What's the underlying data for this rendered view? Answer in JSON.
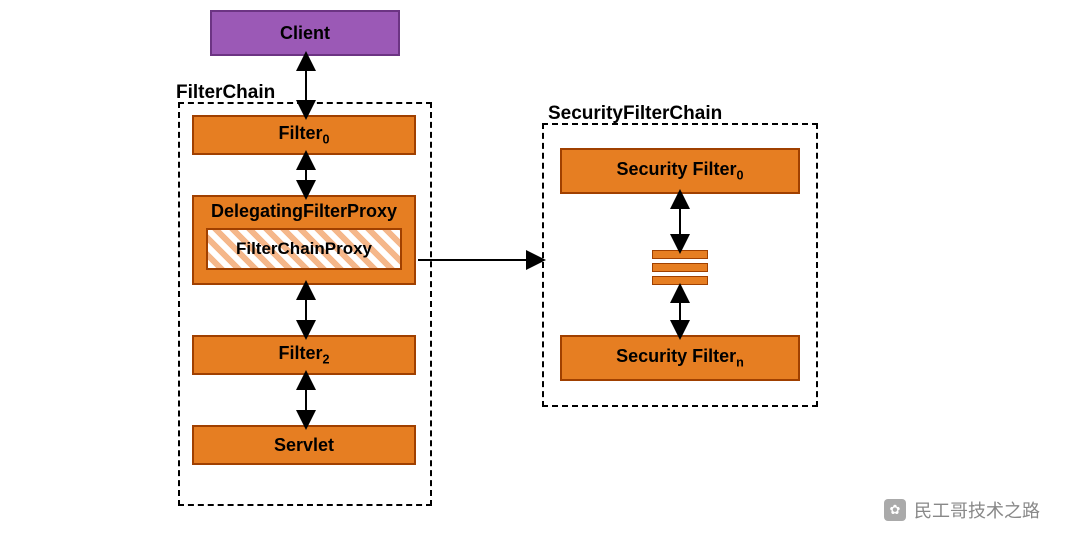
{
  "client": {
    "label": "Client"
  },
  "filterchain": {
    "label": "FilterChain",
    "filter0": "Filter",
    "filter0_sub": "0",
    "delegating": "DelegatingFilterProxy",
    "proxy_inner": "FilterChainProxy",
    "filter2": "Filter",
    "filter2_sub": "2",
    "servlet": "Servlet"
  },
  "securitychain": {
    "label": "SecurityFilterChain",
    "secfilter0": "Security Filter",
    "secfilter0_sub": "0",
    "secfiltern": "Security Filter",
    "secfiltern_sub": "n"
  },
  "watermark": "民工哥技术之路"
}
